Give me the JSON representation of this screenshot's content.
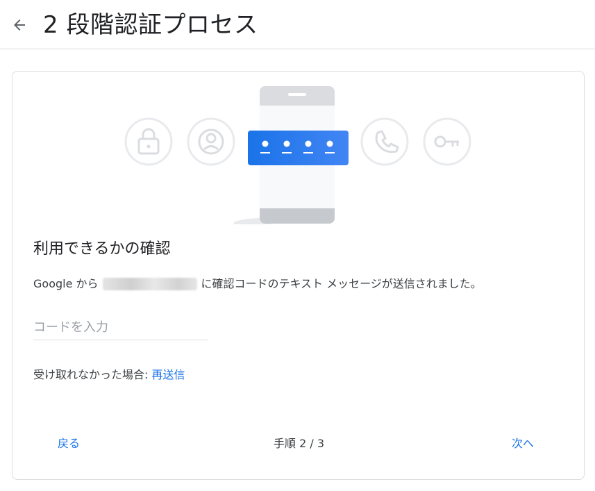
{
  "header": {
    "back_icon": "arrow-left-icon",
    "title": "2 段階認証プロセス"
  },
  "illustration": {
    "icons": [
      "lock-icon",
      "account-circle-icon",
      "phone-icon",
      "key-icon"
    ],
    "accent_color": "#1a73e8"
  },
  "card": {
    "heading": "利用できるかの確認",
    "description_prefix": "Google から",
    "description_suffix": "に確認コードのテキスト メッセージが送信されました。",
    "code_input": {
      "placeholder": "コードを入力",
      "value": ""
    },
    "resend_prompt": "受け取れなかった場合:",
    "resend_link": "再送信"
  },
  "footer": {
    "back_label": "戻る",
    "step_text": "手順 2 / 3",
    "next_label": "次へ"
  }
}
